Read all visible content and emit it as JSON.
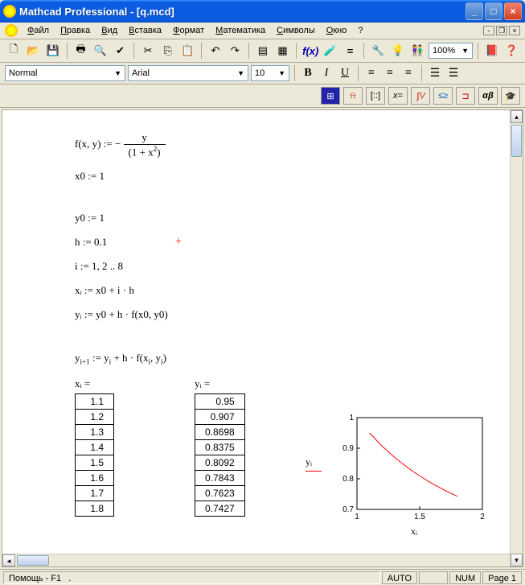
{
  "window": {
    "title": "Mathcad Professional - [q.mcd]"
  },
  "menu": [
    "Файл",
    "Правка",
    "Вид",
    "Вставка",
    "Формат",
    "Математика",
    "Символы",
    "Окно",
    "?"
  ],
  "style_combo": "Normal",
  "font_combo": "Arial",
  "size_combo": "10",
  "zoom_combo": "100%",
  "equations": {
    "e1_left": "f(x, y)",
    "e1_assign": " := ",
    "e1_neg": "−",
    "e1_num": "y",
    "e1_den_open": "(1 + x",
    "e1_den_close": ")",
    "e2": "x0 := 1",
    "e3": "y0 := 1",
    "e4": "h := 0.1",
    "e5": "i := 1, 2 .. 8",
    "e6": "xᵢ := x0 + i · h",
    "e7": "yᵢ := y0 + h · f(x0, y0)",
    "e8_a": "y",
    "e8_b": " := y",
    "e8_c": " + h · f(x",
    "e8_d": ", y",
    "e8_e": ")",
    "sub_i": "i",
    "sub_ip1": "i+1"
  },
  "table_x_header": "xᵢ =",
  "table_y_header": "yᵢ =",
  "chart_xlabel": "xᵢ",
  "chart_ylabel": "yᵢ",
  "chart_data": {
    "type": "line",
    "xlabel": "xᵢ",
    "ylabel": "yᵢ",
    "ylim": [
      0.7,
      1.0
    ],
    "xlim": [
      1,
      2
    ],
    "xticks": [
      1,
      1.5,
      2
    ],
    "yticks": [
      0.7,
      0.8,
      0.9,
      1
    ],
    "series": [
      {
        "name": "yᵢ",
        "color": "#f00",
        "x": [
          1.1,
          1.2,
          1.3,
          1.4,
          1.5,
          1.6,
          1.7,
          1.8
        ],
        "y": [
          0.95,
          0.907,
          0.8698,
          0.8375,
          0.8092,
          0.7843,
          0.7623,
          0.7427
        ]
      }
    ]
  },
  "x_values": [
    "1.1",
    "1.2",
    "1.3",
    "1.4",
    "1.5",
    "1.6",
    "1.7",
    "1.8"
  ],
  "y_values": [
    "0.95",
    "0.907",
    "0.8698",
    "0.8375",
    "0.8092",
    "0.7843",
    "0.7623",
    "0.7427"
  ],
  "status": {
    "help": "Помощь - F1",
    "auto": "AUTO",
    "num": "NUM",
    "page": "Page 1"
  }
}
